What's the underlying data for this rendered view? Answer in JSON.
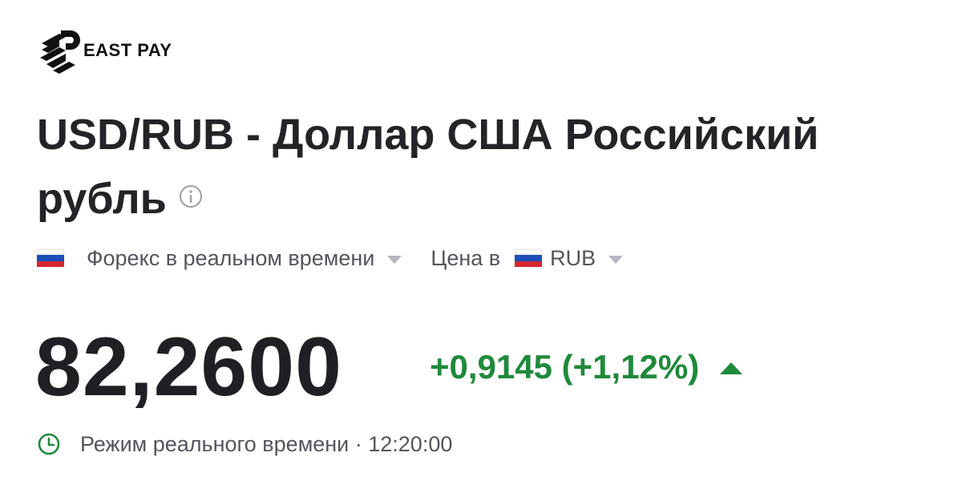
{
  "brand": {
    "name": "EAST PAY",
    "icon": "east-pay-logo"
  },
  "instrument": {
    "title": "USD/RUB - Доллар США Российский рубль",
    "info_icon": "info-icon"
  },
  "meta": {
    "market_flag": "russia-flag",
    "market_label": "Форекс в реальном времени",
    "price_in_label": "Цена в",
    "currency_flag": "russia-flag",
    "currency_code": "RUB"
  },
  "quote": {
    "price": "82,2600",
    "change": "+0,9145 (+1,12%)",
    "direction_icon": "triangle-up-icon",
    "change_color": "#1f8a3b"
  },
  "status": {
    "icon": "clock-icon",
    "text": "Режим реального времени · 12:20:00",
    "accent_color": "#1f8a3b"
  },
  "flag_colors": {
    "white": "#ffffff",
    "blue": "#1d4fb8",
    "red": "#d7262e"
  }
}
